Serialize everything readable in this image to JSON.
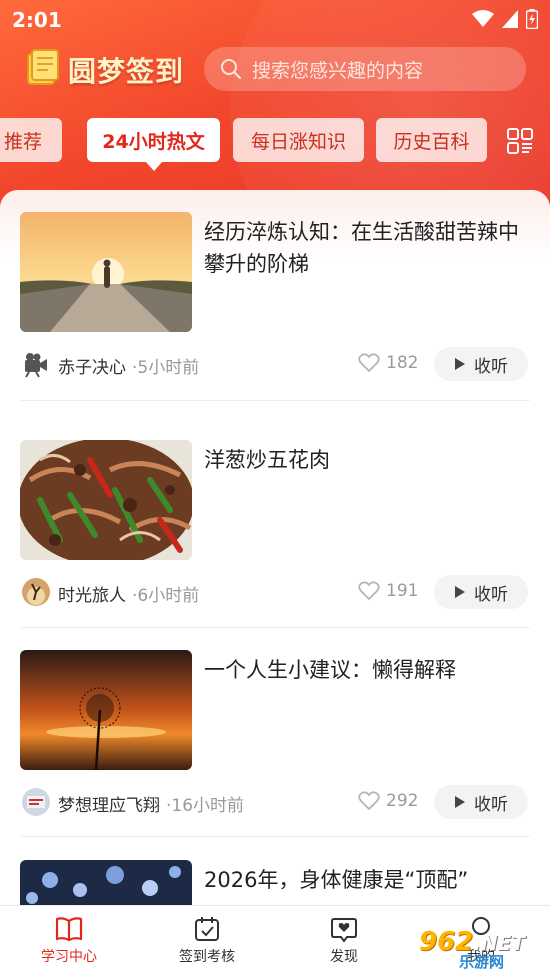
{
  "status_bar": {
    "time": "2:01"
  },
  "app": {
    "title": "圆梦签到"
  },
  "search": {
    "placeholder": "搜索您感兴趣的内容"
  },
  "tabs": [
    {
      "label": "推荐",
      "active": false
    },
    {
      "label": "24小时热文",
      "active": true
    },
    {
      "label": "每日涨知识",
      "active": false
    },
    {
      "label": "历史百科",
      "active": false
    }
  ],
  "articles": [
    {
      "title": "经历淬炼认知：在生活酸甜苦辣中攀升的阶梯",
      "author": "赤子决心",
      "time": "·5小时前",
      "likes": "182",
      "listen_label": "收听",
      "image": "sunset-road-silhouette"
    },
    {
      "title": "洋葱炒五花肉",
      "author": "时光旅人",
      "time": "·6小时前",
      "likes": "191",
      "listen_label": "收听",
      "image": "stir-fried-pork-dish"
    },
    {
      "title": "一个人生小建议：懒得解释",
      "author": "梦想理应飞翔",
      "time": "·16小时前",
      "likes": "292",
      "listen_label": "收听",
      "image": "dandelion-sunset"
    },
    {
      "title": "2026年，身体健康是“顶配”",
      "image": "blue-flowers"
    }
  ],
  "bottom_nav": [
    {
      "label": "学习中心",
      "active": true,
      "icon": "book-icon"
    },
    {
      "label": "签到考核",
      "active": false,
      "icon": "calendar-check-icon"
    },
    {
      "label": "发现",
      "active": false,
      "icon": "discover-icon"
    },
    {
      "label": "我的",
      "active": false,
      "icon": "profile-icon"
    }
  ],
  "watermark": {
    "number": "962",
    "suffix": ".NET",
    "text": "乐游网"
  },
  "colors": {
    "accent": "#e2271c",
    "header": "#f2462c"
  }
}
